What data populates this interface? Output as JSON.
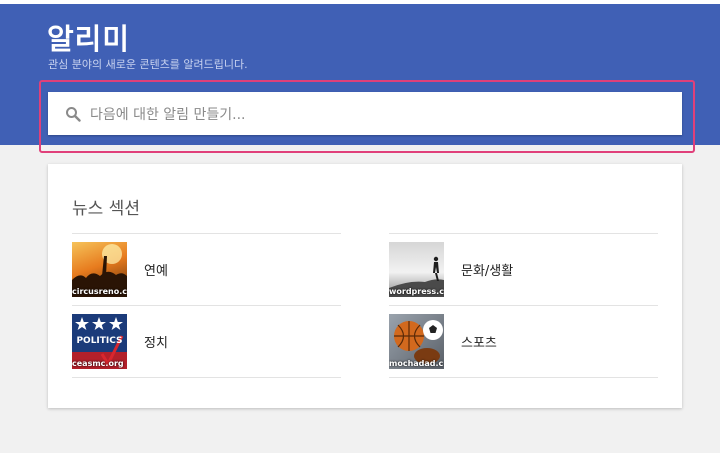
{
  "header": {
    "title": "알리미",
    "subtitle": "관심 분야의 새로운 콘텐츠를 알려드립니다."
  },
  "search": {
    "placeholder": "다음에 대한 알림 만들기...",
    "value": ""
  },
  "news_section": {
    "title": "뉴스 섹션",
    "topics": [
      {
        "label": "연예",
        "thumb_caption": "circusreno.c"
      },
      {
        "label": "문화/생활",
        "thumb_caption": "wordpress.c"
      },
      {
        "label": "정치",
        "thumb_caption": "ceasmc.org",
        "thumb_title": "POLITICS"
      },
      {
        "label": "스포츠",
        "thumb_caption": "mochadad.c"
      }
    ]
  },
  "colors": {
    "header_bg": "#4060b5",
    "highlight_border": "#e0407a",
    "page_bg": "#f1f1f1"
  }
}
